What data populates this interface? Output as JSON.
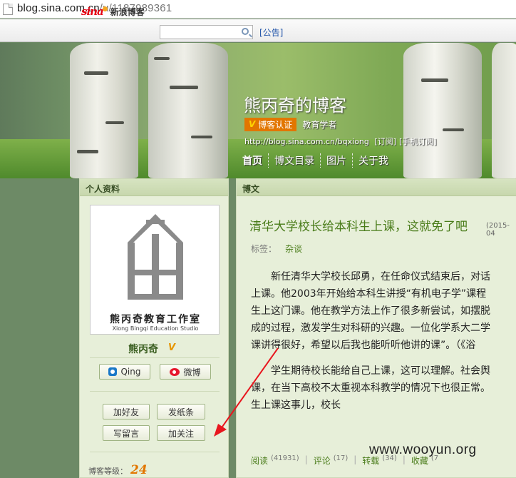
{
  "browser": {
    "url_main": "blog.sina.com.cn",
    "url_path": "/u/1187989361"
  },
  "topnav": {
    "logo_text": "sina",
    "logo_cn": "新浪博客",
    "search_placeholder": "",
    "notice": "[公告]"
  },
  "header": {
    "title": "熊丙奇的博客",
    "badge": "博客认证",
    "badge_v": "V",
    "role": "教育学者",
    "url": "http://blog.sina.com.cn/bqxiong",
    "subscribe": "[订阅]",
    "mobile_subscribe": "[手机订阅]",
    "tabs": [
      "首页",
      "博文目录",
      "图片",
      "关于我"
    ]
  },
  "profile": {
    "panel_title": "个人资料",
    "avatar_caption_cn": "熊丙奇教育工作室",
    "avatar_caption_en": "Xiong Bingqi Education Studio",
    "name": "熊丙奇",
    "v": "V",
    "qing_label": "Qing",
    "weibo_label": "微博",
    "add_friend": "加好友",
    "send_note": "发纸条",
    "leave_message": "写留言",
    "follow": "加关注",
    "level_label": "博客等级：",
    "level_value": "24"
  },
  "article": {
    "panel_title": "博文",
    "title": "清华大学校长给本科生上课，这就免了吧",
    "date": "(2015-04",
    "tags_label": "标签：",
    "tag": "杂谈",
    "para1": [
      "新任清华大学校长邱勇，在任命仪式结束后，对话",
      "上课。他2003年开始给本科生讲授“有机电子学”课程",
      "生上这门课。他在教学方法上作了很多新尝试，如摆脱",
      "成的过程，激发学生对科研的兴趣。一位化学系大二学",
      "课讲得很好，希望以后我也能听听他讲的课”。（《浴"
    ],
    "para2": [
      "学生期待校长能给自己上课，这可以理解。社会舆",
      "课，在当下高校不太重视本科教学的情况下也很正常。",
      "生上课这事儿，校长"
    ],
    "read_label": "阅读",
    "read_count": "(41931)",
    "comment_label": "评论",
    "comment_count": "(17)",
    "repost_label": "转载",
    "repost_count": "(34)",
    "collect_label": "收藏",
    "collect_count": "(7"
  },
  "watermark": "www.wooyun.org",
  "colors": {
    "accent_green": "#4a7c1a",
    "badge_orange": "#e27600",
    "arrow_red": "#e8161e"
  }
}
